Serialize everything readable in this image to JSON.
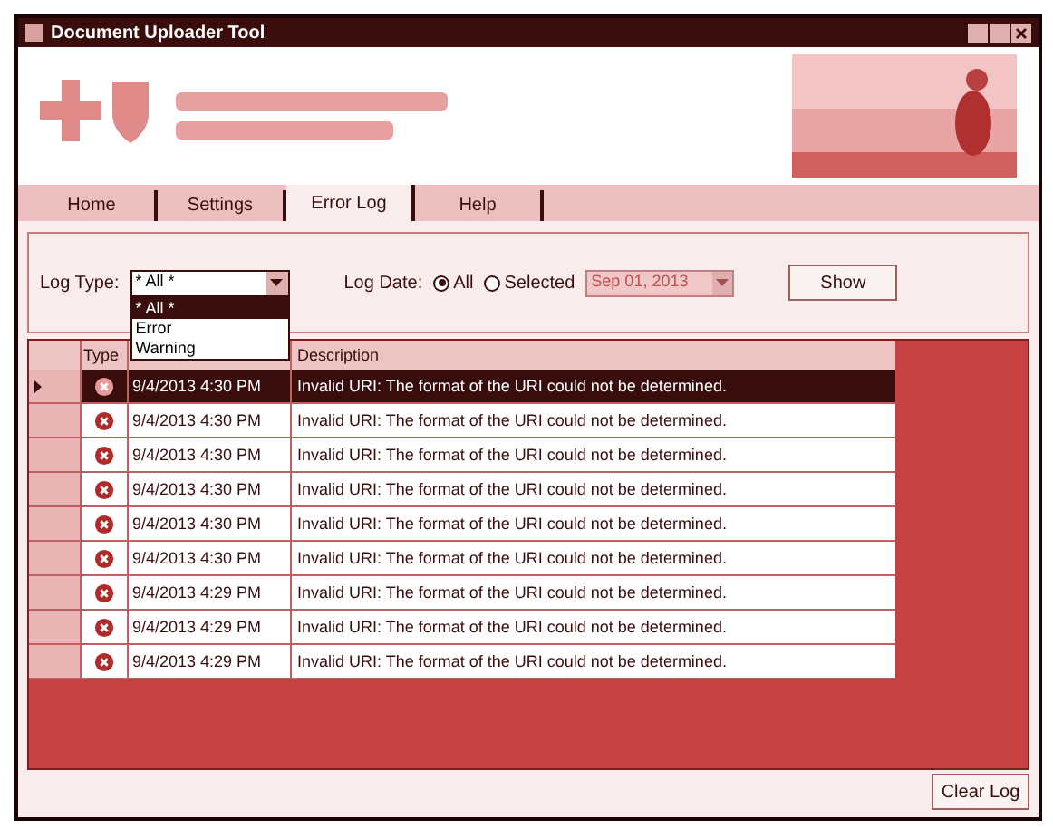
{
  "window": {
    "title": "Document Uploader Tool"
  },
  "tabs": [
    {
      "label": "Home",
      "selected": false
    },
    {
      "label": "Settings",
      "selected": false
    },
    {
      "label": "Error Log",
      "selected": true
    },
    {
      "label": "Help",
      "selected": false
    }
  ],
  "filters": {
    "log_type_label": "Log Type:",
    "log_type_value": "* All *",
    "log_type_options": [
      {
        "label": "* All *",
        "selected": true
      },
      {
        "label": "Error",
        "selected": false
      },
      {
        "label": "Warning",
        "selected": false
      }
    ],
    "log_date_label": "Log Date:",
    "date_options": [
      {
        "label": "All",
        "selected": true
      },
      {
        "label": "Selected",
        "selected": false
      }
    ],
    "date_value": "Sep 01, 2013",
    "show_button": "Show"
  },
  "table": {
    "columns": [
      "Type",
      "Description"
    ],
    "rows": [
      {
        "date": "9/4/2013 4:30 PM",
        "description": "Invalid URI: The format of the URI could not be determined.",
        "selected": true
      },
      {
        "date": "9/4/2013 4:30 PM",
        "description": "Invalid URI: The format of the URI could not be determined.",
        "selected": false
      },
      {
        "date": "9/4/2013 4:30 PM",
        "description": "Invalid URI: The format of the URI could not be determined.",
        "selected": false
      },
      {
        "date": "9/4/2013 4:30 PM",
        "description": "Invalid URI: The format of the URI could not be determined.",
        "selected": false
      },
      {
        "date": "9/4/2013 4:30 PM",
        "description": "Invalid URI: The format of the URI could not be determined.",
        "selected": false
      },
      {
        "date": "9/4/2013 4:30 PM",
        "description": "Invalid URI: The format of the URI could not be determined.",
        "selected": false
      },
      {
        "date": "9/4/2013 4:29 PM",
        "description": "Invalid URI: The format of the URI could not be determined.",
        "selected": false
      },
      {
        "date": "9/4/2013 4:29 PM",
        "description": "Invalid URI: The format of the URI could not be determined.",
        "selected": false
      },
      {
        "date": "9/4/2013 4:29 PM",
        "description": "Invalid URI: The format of the URI could not be determined.",
        "selected": false
      }
    ]
  },
  "clear_button": "Clear Log"
}
